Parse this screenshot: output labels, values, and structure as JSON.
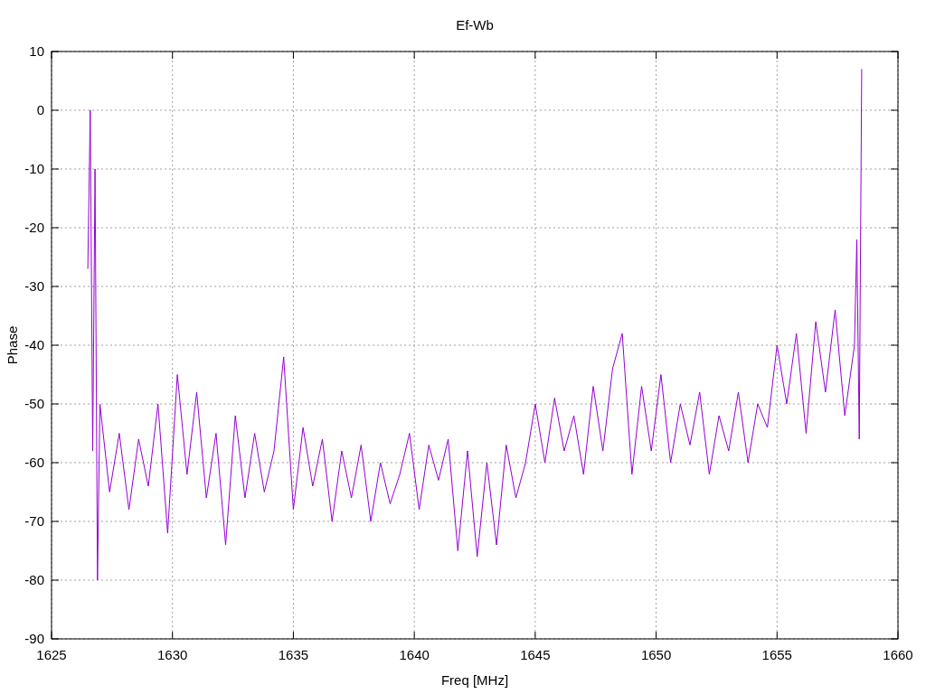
{
  "chart": {
    "chart_data": {
      "type": "line",
      "title": "Ef-Wb",
      "xlabel": "Freq [MHz]",
      "ylabel": "Phase",
      "grid": true,
      "xlim": [
        1625,
        1660
      ],
      "ylim": [
        -90,
        10
      ],
      "xticks": [
        1625,
        1630,
        1635,
        1640,
        1645,
        1650,
        1655,
        1660
      ],
      "yticks": [
        -90,
        -80,
        -70,
        -60,
        -50,
        -40,
        -30,
        -20,
        -10,
        0,
        10
      ],
      "x": [
        1626.5,
        1626.6,
        1626.7,
        1626.8,
        1626.9,
        1627.0,
        1627.4,
        1627.8,
        1628.2,
        1628.6,
        1629.0,
        1629.4,
        1629.8,
        1630.2,
        1630.6,
        1631.0,
        1631.4,
        1631.8,
        1632.2,
        1632.6,
        1633.0,
        1633.4,
        1633.8,
        1634.2,
        1634.6,
        1635.0,
        1635.4,
        1635.8,
        1636.2,
        1636.6,
        1637.0,
        1637.4,
        1637.8,
        1638.2,
        1638.6,
        1639.0,
        1639.4,
        1639.8,
        1640.2,
        1640.6,
        1641.0,
        1641.4,
        1641.8,
        1642.2,
        1642.6,
        1643.0,
        1643.4,
        1643.8,
        1644.2,
        1644.6,
        1645.0,
        1645.4,
        1645.8,
        1646.2,
        1646.6,
        1647.0,
        1647.4,
        1647.8,
        1648.2,
        1648.6,
        1649.0,
        1649.4,
        1649.8,
        1650.2,
        1650.6,
        1651.0,
        1651.4,
        1651.8,
        1652.2,
        1652.6,
        1653.0,
        1653.4,
        1653.8,
        1654.2,
        1654.6,
        1655.0,
        1655.4,
        1655.8,
        1656.2,
        1656.6,
        1657.0,
        1657.4,
        1657.8,
        1658.2,
        1658.3,
        1658.4,
        1658.5
      ],
      "series": [
        {
          "color": "#9400d3",
          "values": [
            -27,
            0,
            -58,
            -10,
            -80,
            -50,
            -65,
            -55,
            -68,
            -56,
            -64,
            -50,
            -72,
            -45,
            -62,
            -48,
            -66,
            -55,
            -74,
            -52,
            -66,
            -55,
            -65,
            -58,
            -42,
            -68,
            -54,
            -64,
            -56,
            -70,
            -58,
            -66,
            -57,
            -70,
            -60,
            -67,
            -62,
            -55,
            -68,
            -57,
            -63,
            -56,
            -75,
            -58,
            -76,
            -60,
            -74,
            -57,
            -66,
            -60,
            -50,
            -60,
            -49,
            -58,
            -52,
            -62,
            -47,
            -58,
            -44,
            -38,
            -62,
            -47,
            -58,
            -45,
            -60,
            -50,
            -57,
            -48,
            -62,
            -52,
            -58,
            -48,
            -60,
            -50,
            -54,
            -40,
            -50,
            -38,
            -55,
            -36,
            -48,
            -34,
            -52,
            -40,
            -22,
            -56,
            7
          ]
        }
      ]
    }
  }
}
